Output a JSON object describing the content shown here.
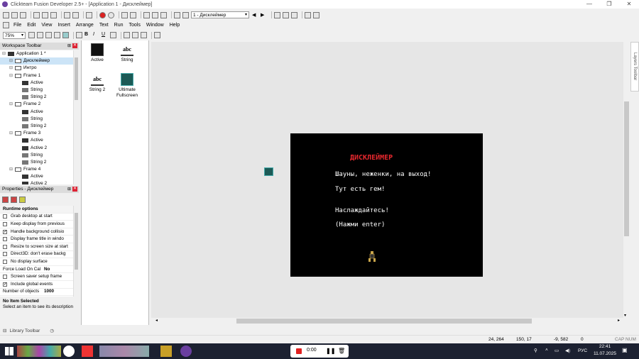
{
  "window": {
    "title": "Clickteam Fusion Developer 2.5+ - [Application 1 - Дисклеймер]"
  },
  "toolbar": {
    "frame_select": "1 - Дисклеймер"
  },
  "menu": [
    "File",
    "Edit",
    "View",
    "Insert",
    "Arrange",
    "Text",
    "Run",
    "Tools",
    "Window",
    "Help"
  ],
  "toolbar2": {
    "zoom": "75%"
  },
  "workspace": {
    "header": "Workspace Toolbar",
    "tree": [
      {
        "label": "Application 1 *",
        "level": 0,
        "type": "app"
      },
      {
        "label": "Дисклеймер",
        "level": 1,
        "type": "frame"
      },
      {
        "label": "Интро",
        "level": 1,
        "type": "frame"
      },
      {
        "label": "Frame 1",
        "level": 1,
        "type": "frame"
      },
      {
        "label": "Active",
        "level": 2,
        "type": "active"
      },
      {
        "label": "String",
        "level": 2,
        "type": "string"
      },
      {
        "label": "String 2",
        "level": 2,
        "type": "string"
      },
      {
        "label": "Frame 2",
        "level": 1,
        "type": "frame"
      },
      {
        "label": "Active",
        "level": 2,
        "type": "active"
      },
      {
        "label": "String",
        "level": 2,
        "type": "string"
      },
      {
        "label": "String 2",
        "level": 2,
        "type": "string"
      },
      {
        "label": "Frame 3",
        "level": 1,
        "type": "frame"
      },
      {
        "label": "Active",
        "level": 2,
        "type": "active"
      },
      {
        "label": "Active 2",
        "level": 2,
        "type": "active"
      },
      {
        "label": "String",
        "level": 2,
        "type": "string"
      },
      {
        "label": "String 2",
        "level": 2,
        "type": "string"
      },
      {
        "label": "Frame 4",
        "level": 1,
        "type": "frame"
      },
      {
        "label": "Active",
        "level": 2,
        "type": "active"
      },
      {
        "label": "Active 2",
        "level": 2,
        "type": "active"
      }
    ]
  },
  "properties": {
    "header": "Properties - Дисклеймер",
    "rows": [
      {
        "label": "Runtime options",
        "group": true
      },
      {
        "label": "Grab desktop at start",
        "checked": false
      },
      {
        "label": "Keep display from previous",
        "checked": false
      },
      {
        "label": "Handle background collisio",
        "checked": true
      },
      {
        "label": "Display frame title in windo",
        "checked": false
      },
      {
        "label": "Resize to screen size at start",
        "checked": false
      },
      {
        "label": "Direct3D: don't erase backg",
        "checked": false
      },
      {
        "label": "No display surface",
        "checked": false
      },
      {
        "label": "Force Load On Cal",
        "value": "No"
      },
      {
        "label": "Screen saver setup frame",
        "checked": false
      },
      {
        "label": "Include global events",
        "checked": true
      },
      {
        "label": "Number of objects",
        "value": "1000"
      }
    ],
    "desc_title": "No Item Selected",
    "desc_text": "Select an item to see its description"
  },
  "library_tab": "Library Toolbar",
  "objects": [
    {
      "label": "Active",
      "icon": "active-icon"
    },
    {
      "label": "String",
      "icon": "string-icon"
    },
    {
      "label": "String 2",
      "icon": "string-icon"
    },
    {
      "label": "Ultimate Fullscreen",
      "icon": "fullscreen-icon"
    }
  ],
  "game": {
    "title": "ДИСКЛЕЙМЕР",
    "lines": [
      "Шауны, неженки, на выход!",
      "Тут есть гем!",
      "Наслаждайтесь!",
      "(Нажми enter)"
    ]
  },
  "layers_tab": "Layers Toolbar",
  "status": {
    "coords1": "24, 264",
    "coords2": "150, 17",
    "coords3": "-9, 582",
    "coords4": "0",
    "caps": "CAP NUM"
  },
  "recorder": {
    "time": "0:00"
  },
  "tray": {
    "lang": "РУС",
    "time": "22:41",
    "date": "11.07.2025"
  },
  "colors": {
    "game_title": "#e8282e",
    "editor_bg": "#e6e6e6",
    "taskbar": "#1c2131"
  }
}
